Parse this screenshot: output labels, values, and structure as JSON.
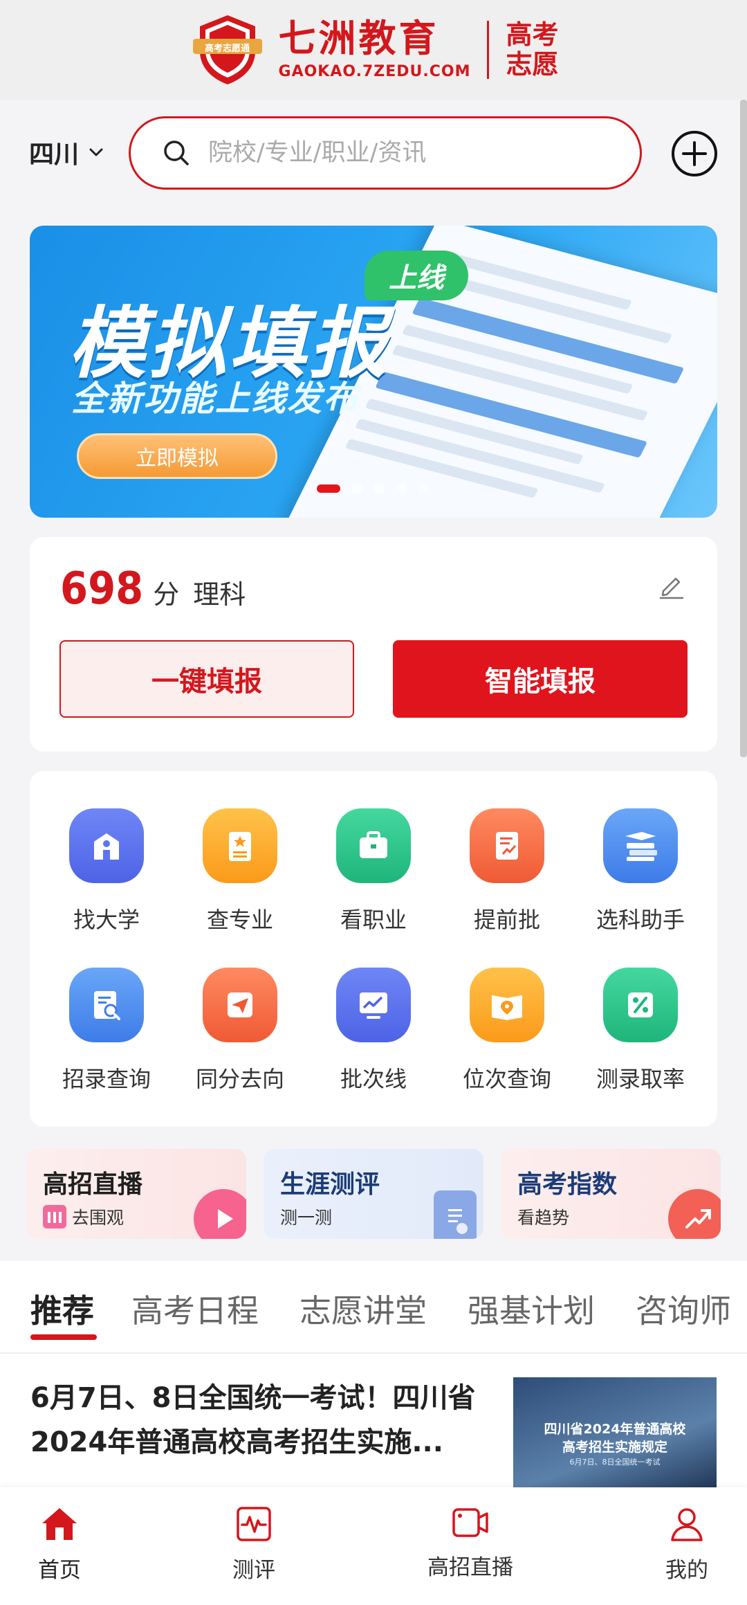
{
  "header": {
    "brand_name": "七洲教育",
    "brand_url": "GAOKAO.7ZEDU.COM",
    "brand_side_1": "高考",
    "brand_side_2": "志愿",
    "badge_text": "高考志愿通"
  },
  "search": {
    "province": "四川",
    "placeholder": "院校/专业/职业/资讯"
  },
  "banner": {
    "title": "模拟填报",
    "subtitle": "全新功能上线发布",
    "tag": "上线",
    "button": "立即模拟",
    "slide_count": 5,
    "active_slide": 1
  },
  "score": {
    "value": "698",
    "unit": "分",
    "subject": "理科",
    "btn_one_click": "一键填报",
    "btn_smart": "智能填报"
  },
  "features": [
    {
      "label": "找大学",
      "icon": "university-icon",
      "color": "#5b74f0"
    },
    {
      "label": "查专业",
      "icon": "major-book-icon",
      "color": "#fdae2b"
    },
    {
      "label": "看职业",
      "icon": "briefcase-icon",
      "color": "#2ec88e"
    },
    {
      "label": "提前批",
      "icon": "document-chart-icon",
      "color": "#f56a4a"
    },
    {
      "label": "选科助手",
      "icon": "books-cap-icon",
      "color": "#4c8af1"
    },
    {
      "label": "招录查询",
      "icon": "doc-search-icon",
      "color": "#4c8af1"
    },
    {
      "label": "同分去向",
      "icon": "paper-plane-icon",
      "color": "#f56a4a"
    },
    {
      "label": "批次线",
      "icon": "line-chart-icon",
      "color": "#5b74f0"
    },
    {
      "label": "位次查询",
      "icon": "map-pin-book-icon",
      "color": "#fdae2b"
    },
    {
      "label": "测录取率",
      "icon": "percent-icon",
      "color": "#2ec88e"
    }
  ],
  "promos": [
    {
      "title": "高招直播",
      "sub": "去围观",
      "icon": "play-icon",
      "bg": "#fdeeee"
    },
    {
      "title": "生涯测评",
      "sub": "测一测",
      "icon": "clipboard-icon",
      "bg": "#eaf0fb"
    },
    {
      "title": "高考指数",
      "sub": "看趋势",
      "icon": "trend-icon",
      "bg": "#fdeeee"
    }
  ],
  "tabs": [
    "推荐",
    "高考日程",
    "志愿讲堂",
    "强基计划",
    "咨询师"
  ],
  "news": {
    "title": "6月7日、8日全国统一考试！四川省2024年普通高校高考招生实施...",
    "thumb_line1": "四川省2024年普通高校",
    "thumb_line2": "高考招生实施规定",
    "thumb_line3": "6月7日、8日全国统一考试"
  },
  "bottom_nav": [
    {
      "label": "首页",
      "icon": "home-icon",
      "active": true
    },
    {
      "label": "测评",
      "icon": "pulse-icon",
      "active": false
    },
    {
      "label": "高招直播",
      "icon": "video-icon",
      "active": false
    },
    {
      "label": "我的",
      "icon": "user-icon",
      "active": false
    }
  ],
  "colors": {
    "accent": "#d4171c",
    "accent_bg": "#fdeeee"
  }
}
